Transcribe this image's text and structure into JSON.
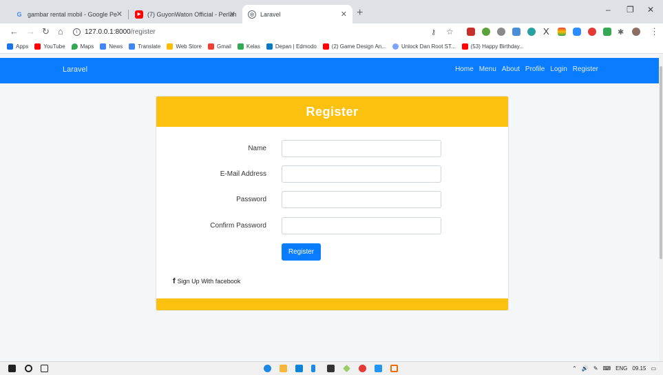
{
  "browser": {
    "tabs": [
      {
        "title": "gambar rental mobil - Google Pe",
        "icon": "google-icon",
        "active": false
      },
      {
        "title": "(7) GuyonWaton Official - Perlah",
        "icon": "youtube-icon",
        "active": false
      },
      {
        "title": "Laravel",
        "icon": "globe-icon",
        "active": true
      }
    ],
    "new_tab": "+",
    "window_controls": {
      "minimize": "–",
      "maximize": "❐",
      "close": "✕"
    },
    "url": {
      "host": "127.0.0.1:8000",
      "path": "/register"
    },
    "bookmarks": [
      {
        "label": "Apps",
        "color": "#1a73e8"
      },
      {
        "label": "YouTube",
        "color": "#ff0000"
      },
      {
        "label": "Maps",
        "color": "#34a853"
      },
      {
        "label": "News",
        "color": "#4285f4"
      },
      {
        "label": "Translate",
        "color": "#4285f4"
      },
      {
        "label": "Web Store",
        "color": "#fbbc04"
      },
      {
        "label": "Gmail",
        "color": "#ea4335"
      },
      {
        "label": "Kelas",
        "color": "#34a853"
      },
      {
        "label": "Depan | Edmodo",
        "color": "#0b78bf"
      },
      {
        "label": "(2) Game Design An...",
        "color": "#ff0000"
      },
      {
        "label": "Unlock Dan Root ST...",
        "color": "#7da2ff"
      },
      {
        "label": "(53) Happy Birthday...",
        "color": "#ff0000"
      }
    ]
  },
  "navbar": {
    "brand": "Laravel",
    "links": [
      "Home",
      "Menu",
      "About",
      "Profile",
      "Login",
      "Register"
    ]
  },
  "form": {
    "title": "Register",
    "fields": [
      {
        "label": "Name",
        "value": ""
      },
      {
        "label": "E-Mail Address",
        "value": ""
      },
      {
        "label": "Password",
        "value": ""
      },
      {
        "label": "Confirm Password",
        "value": ""
      }
    ],
    "submit_label": "Register",
    "facebook_icon": "f",
    "facebook_label": "Sign Up With facebook"
  },
  "taskbar": {
    "language": "ENG",
    "time": "09.15"
  },
  "colors": {
    "navbar": "#0a7cff",
    "card_header": "#fcc10e",
    "button": "#0a7cff"
  }
}
